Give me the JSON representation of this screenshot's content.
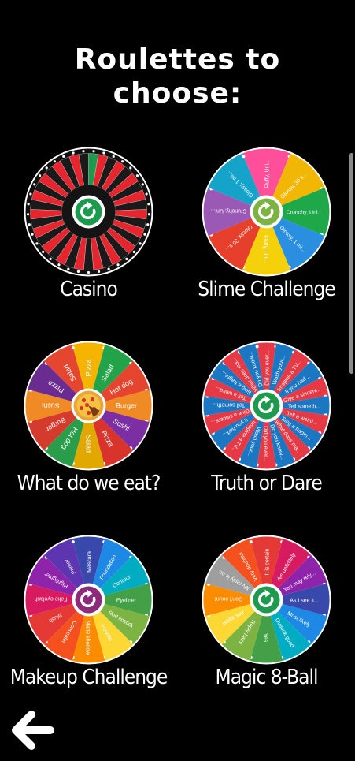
{
  "header": {
    "title": "Roulettes to\nchoose:"
  },
  "roulettes": [
    {
      "label": "Casino",
      "colors": [
        "#e6262e",
        "#1a1a1a"
      ],
      "slices": []
    },
    {
      "label": "Slime Challenge",
      "colors": [
        "#ff4f9a",
        "#f2b705",
        "#1fa84a",
        "#2a8fe0",
        "#f4d10b",
        "#e63f2b",
        "#9b59b6",
        "#15a3c9"
      ],
      "slices": [
        "Fluffy, Uni...",
        "Glossy, 30 s...",
        "Crunchy, Uni...",
        "Glossy, 1 mi...",
        "Fluffy, Uni...",
        "Glossy, 30 s...",
        "Crunchy, Uni...",
        "Glossy, 1 mi..."
      ]
    },
    {
      "label": "What do we eat?",
      "colors": [
        "#f4b400",
        "#22a34a",
        "#e5452f",
        "#f08a24",
        "#7b2fa2",
        "#d9342b",
        "#e0a800",
        "#2a9d4a",
        "#d43b2c",
        "#f08a24",
        "#6a2c91",
        "#e4462f"
      ],
      "slices": [
        "Pizza",
        "Salad",
        "Hot dog",
        "Burger",
        "Sushi",
        "Pizza",
        "Salad",
        "Hot dog",
        "Burger",
        "Sushi"
      ]
    },
    {
      "label": "Truth or Dare",
      "colors": [
        "#e53945",
        "#1c77c3"
      ],
      "slices": [
        "Did you ever...",
        "Wash your...",
        "Imagine a TV...",
        "If you had...",
        "Give a sincere...",
        "Tell someth...",
        "Tell a weird...",
        "Sing a fragm...",
        "What does ma...",
        "Do you know..."
      ]
    },
    {
      "label": "Makeup Challenge",
      "colors": [
        "#3949ab",
        "#1e88e5",
        "#00acc1",
        "#43a047",
        "#7cb342",
        "#fdd835",
        "#fb8c00",
        "#f4511e",
        "#e53935",
        "#d81b60",
        "#8e24aa",
        "#5e35b1"
      ],
      "slices": [
        "Mascara",
        "Foundation",
        "Contour",
        "Eyeliner",
        "Red lipstick",
        "Powder",
        "Matte shadow",
        "Concealer",
        "Blush",
        "Fake eyelash",
        "Highlighter",
        "Primer"
      ]
    },
    {
      "label": "Magic 8-Ball",
      "colors": [
        "#e53935",
        "#d81b60",
        "#8e24aa",
        "#3949ab",
        "#1e88e5",
        "#00acc1",
        "#43a047",
        "#7cb342",
        "#fdd835",
        "#fb8c00",
        "#9e9e9e",
        "#f4511e"
      ],
      "slices": [
        "It is certain",
        "Yes definitely",
        "You may rely...",
        "As I see it...",
        "Most likely",
        "Outlook good",
        "Yes",
        "Reply hazy",
        "Ask again",
        "Don't count",
        "My reply is no",
        "Very doubtful"
      ]
    }
  ],
  "nav": {
    "back_icon": "arrow-left-icon"
  },
  "colors": {
    "background": "#000000",
    "hub": "#1e9a4f",
    "hub_ring": "#ffffff"
  }
}
